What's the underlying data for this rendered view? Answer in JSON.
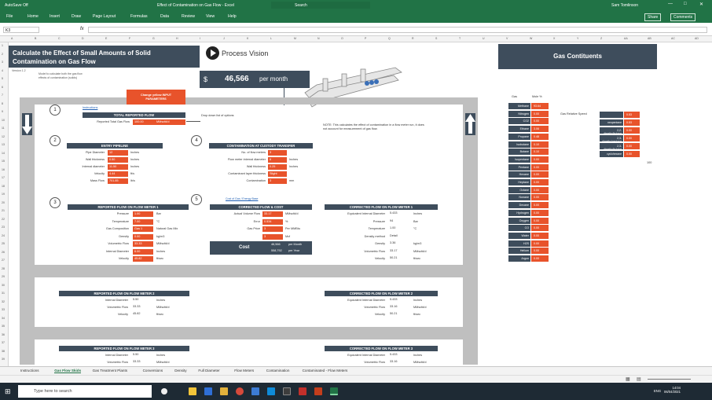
{
  "window": {
    "autosave": "AutoSave",
    "autosave_state": "Off",
    "title": "Effect of Contamination on Gas Flow - Excel",
    "search": "Search",
    "user": "Sam Tomlinson",
    "controls": [
      "—",
      "□",
      "✕"
    ]
  },
  "menu": {
    "items": [
      "File",
      "Home",
      "Insert",
      "Draw",
      "Page Layout",
      "Formulas",
      "Data",
      "Review",
      "View",
      "Help"
    ],
    "share": "Share",
    "comments": "Comments"
  },
  "formula": {
    "namebox": "K3",
    "fx": "fx",
    "value": ""
  },
  "columns": [
    "A",
    "B",
    "C",
    "D",
    "E",
    "F",
    "G",
    "H",
    "I",
    "J",
    "K",
    "L",
    "M",
    "N",
    "O",
    "P",
    "Q",
    "R",
    "S",
    "T",
    "U",
    "V",
    "W",
    "X",
    "Y",
    "Z",
    "AA",
    "AB",
    "AC",
    "AD"
  ],
  "rows": [
    "1",
    "2",
    "3",
    "4",
    "5",
    "6",
    "7",
    "8",
    "9",
    "10",
    "11",
    "12",
    "13",
    "14",
    "15",
    "16",
    "17",
    "18",
    "19",
    "20",
    "21",
    "22",
    "23",
    "24",
    "25",
    "26",
    "27",
    "28",
    "29",
    "30",
    "31",
    "32",
    "33",
    "34",
    "35",
    "36",
    "37",
    "38",
    "39"
  ],
  "header": {
    "title": "Calculate the Effect of Small Amounts of Solid Contamination on Gas Flow",
    "version": "Version 1.2",
    "subtitle": "Model to calculate both the gas flow effects of contamination (solids)",
    "brand": "Process Vision",
    "cost_currency": "$",
    "cost_value": "46,566",
    "cost_unit": "per month"
  },
  "change_values_button": "Change yellow INPUT PARAMETERS",
  "instructions_link": "Instructions",
  "section1": {
    "header": "TOTAL REPORTED FLOW",
    "label": "Reported Total Gas Flow",
    "value": "100.00",
    "unit": "MMscfd/d",
    "note": "Drop down list of options"
  },
  "note_text": "NOTE: This calculates the effect of contamination in a flow meter run, it does not account for measurement of gas flow.",
  "section2": {
    "header": "ENTRY PIPELINE",
    "rows": [
      {
        "label": "Pipe Diameter",
        "value": "12",
        "unit": "Inches"
      },
      {
        "label": "Wall thickness",
        "value": "0.50",
        "unit": "Inches"
      },
      {
        "label": "Internal diameter",
        "value": "11.50",
        "unit": "Inches"
      },
      {
        "label": "Velocity",
        "value": "4.44",
        "unit": "ft/s"
      },
      {
        "label": "Mass Flow",
        "value": "701.85",
        "unit": "lb/s"
      }
    ]
  },
  "section4": {
    "header": "CONTAMINATION AT CUSTODY TRANSFER",
    "rows": [
      {
        "label": "No. of flow meters",
        "value": "3",
        "unit": ""
      },
      {
        "label": "Flow meter internal diameter",
        "value": "6",
        "unit": "Inches"
      },
      {
        "label": "Wall thickness",
        "value": "0.25",
        "unit": "Inches"
      },
      {
        "label": "Contaminant layer thickness",
        "value": "Slight",
        "unit": ""
      },
      {
        "label": "Contamination",
        "value": "3",
        "unit": "mm"
      }
    ]
  },
  "section3": {
    "header": "REPORTED FLOW ON FLOW METER 1",
    "rows": [
      {
        "label": "Pressure",
        "value": "1.00",
        "unit": "Bar"
      },
      {
        "label": "Temperature",
        "value": "7.00",
        "unit": "°C"
      },
      {
        "label": "Gas Composition",
        "value": "Gas 1",
        "unit": "Natural Gas Mix"
      },
      {
        "label": "Density",
        "value": "0.00",
        "unit": "kg/m3"
      },
      {
        "label": "Volumetric Flow",
        "value": "33.33",
        "unit": "MMscfd/d"
      },
      {
        "label": "Internal Diameter",
        "value": "6.00",
        "unit": "Inches"
      },
      {
        "label": "Velocity",
        "value": "45.82",
        "unit": "ft/sec"
      }
    ]
  },
  "section5": {
    "link": "Cost of Gas / Energy Base",
    "header": "CORRECTED FLOW & COST",
    "rows": [
      {
        "label": "Actual Volume Flow",
        "value": "33.17",
        "unit": "MMscfd/d"
      },
      {
        "label": "Error",
        "value": "0.534",
        "unit": "%"
      },
      {
        "label": "Gas Price",
        "value": "3",
        "unit": "Per MMBtu"
      },
      {
        "label": "",
        "value": "3",
        "unit": "Mcf"
      }
    ],
    "cost_label": "Cost",
    "cost_monthly": "46,566",
    "cost_monthly_unit": "per Month",
    "cost_yearly": "558,792",
    "cost_yearly_unit": "per Year"
  },
  "corrected1": {
    "header": "CORRECTED FLOW ON FLOW METER 1",
    "rows": [
      {
        "label": "Equivalent Internal Diameter",
        "value": "5.433",
        "unit": "Inches"
      },
      {
        "label": "Pressure",
        "value": "94",
        "unit": "Bar"
      },
      {
        "label": "Temperature",
        "value": "1.00",
        "unit": "°C"
      },
      {
        "label": "Density method",
        "value": "Detail",
        "unit": ""
      },
      {
        "label": "Density",
        "value": "3.36",
        "unit": "kg/m3"
      },
      {
        "label": "Volumetric Flow",
        "value": "33.17",
        "unit": "MMscfd/d"
      },
      {
        "label": "Velocity",
        "value": "50.21",
        "unit": "ft/sec"
      }
    ]
  },
  "reported2": {
    "header": "REPORTED FLOW ON FLOW METER 2",
    "rows": [
      {
        "label": "Internal Diameter",
        "value": "5.50",
        "unit": "Inches"
      },
      {
        "label": "Volumetric Flow",
        "value": "33.33",
        "unit": "MMscfd/d"
      },
      {
        "label": "Velocity",
        "value": "45.82",
        "unit": "ft/sec"
      }
    ]
  },
  "corrected2": {
    "header": "CORRECTED FLOW ON FLOW METER 2",
    "rows": [
      {
        "label": "Equivalent Internal Diameter",
        "value": "5.433",
        "unit": "Inches"
      },
      {
        "label": "Volumetric Flow",
        "value": "33.16",
        "unit": "MMscfd/d"
      },
      {
        "label": "Velocity",
        "value": "50.21",
        "unit": "ft/sec"
      }
    ]
  },
  "reported3": {
    "header": "REPORTED FLOW ON FLOW METER 3",
    "rows": [
      {
        "label": "Internal Diameter",
        "value": "5.50",
        "unit": "Inches"
      },
      {
        "label": "Volumetric Flow",
        "value": "33.33",
        "unit": "MMscfd/d"
      }
    ]
  },
  "corrected3": {
    "header": "CORRECTED FLOW ON FLOW METER 3",
    "rows": [
      {
        "label": "Equivalent Internal Diameter",
        "value": "5.433",
        "unit": "Inches"
      },
      {
        "label": "Volumetric Flow",
        "value": "33.16",
        "unit": "MMscfd/d"
      }
    ]
  },
  "constituents": {
    "title": "Gas Contituents",
    "col_gas": "Gas",
    "col_mole": "Mole %",
    "rows": [
      {
        "gas": "Methane",
        "mole": "93.64"
      },
      {
        "gas": "Nitrogen",
        "mole": "0.00"
      },
      {
        "gas": "CO2",
        "mole": "0.00"
      },
      {
        "gas": "Ethane",
        "mole": "3.06"
      },
      {
        "gas": "Propane",
        "mole": "0.48"
      },
      {
        "gas": "Isobutane",
        "mole": "0.10"
      },
      {
        "gas": "Butane",
        "mole": "0.10"
      },
      {
        "gas": "Isopentane",
        "mole": "0.00"
      },
      {
        "gas": "Pentane",
        "mole": "0.00"
      },
      {
        "gas": "Hexane",
        "mole": "0.00"
      },
      {
        "gas": "Heptane",
        "mole": "0.00"
      },
      {
        "gas": "Octane",
        "mole": "0.00"
      },
      {
        "gas": "Nonane",
        "mole": "0.00"
      },
      {
        "gas": "Decane",
        "mole": "0.00"
      },
      {
        "gas": "Hydrogen",
        "mole": "0.00"
      },
      {
        "gas": "Oxygen",
        "mole": "0.00"
      },
      {
        "gas": "CO",
        "mole": "0.00"
      },
      {
        "gas": "Water",
        "mole": "0.00"
      },
      {
        "gas": "H2S",
        "mole": "0.00"
      },
      {
        "gas": "Helium",
        "mole": "0.00"
      },
      {
        "gas": "Argon",
        "mole": "0.00"
      }
    ],
    "side_header": "Gas Relative Speed",
    "side_rows": [
      {
        "label": "",
        "value": "0.53"
      },
      {
        "label": "neopentane",
        "value": "0.53"
      },
      {
        "label": "2,2-dimethylbutane",
        "value": "0.00"
      },
      {
        "label": "2,3-dimethylpentane",
        "value": "0.00"
      },
      {
        "label": "2,3-dimethylbutane",
        "value": "0.00"
      },
      {
        "label": "cyclohexane",
        "value": "0.00"
      }
    ],
    "total": "100"
  },
  "sheet_tabs": [
    "Instructions",
    "Gas Flow Skids",
    "Gas Treatment Plants",
    "Conversions",
    "Density",
    "Full Diameter",
    "Flow Meters",
    "Contamination",
    "Contaminated - Flow Meters"
  ],
  "active_tab": "Gas Flow Skids",
  "taskbar": {
    "search": "Type here to search",
    "lang": "ENG",
    "time": "14:04",
    "date": "06/04/2021"
  },
  "colors": {
    "excel_green": "#217346",
    "navy": "#3e4d5c",
    "orange": "#e8532b",
    "pipe": "#bfbfbf"
  }
}
